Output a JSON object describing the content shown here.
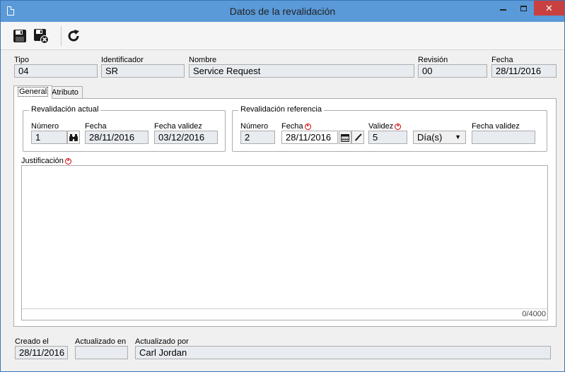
{
  "window": {
    "title": "Datos de la revalidación"
  },
  "header": {
    "tipo": {
      "label": "Tipo",
      "value": "04"
    },
    "identificador": {
      "label": "Identificador",
      "value": "SR"
    },
    "nombre": {
      "label": "Nombre",
      "value": "Service Request"
    },
    "revision": {
      "label": "Revisión",
      "value": "00"
    },
    "fecha": {
      "label": "Fecha",
      "value": "28/11/2016"
    }
  },
  "tabs": [
    {
      "label": "General"
    },
    {
      "label": "Atributo"
    }
  ],
  "revalidacion_actual": {
    "title": "Revalidación actual",
    "numero": {
      "label": "Número",
      "value": "1"
    },
    "fecha": {
      "label": "Fecha",
      "value": "28/11/2016"
    },
    "fecha_validez": {
      "label": "Fecha validez",
      "value": "03/12/2016"
    }
  },
  "revalidacion_referencia": {
    "title": "Revalidación referencia",
    "numero": {
      "label": "Número",
      "value": "2"
    },
    "fecha": {
      "label": "Fecha",
      "value": "28/11/2016"
    },
    "validez": {
      "label": "Validez",
      "value": "5"
    },
    "unidad": {
      "value": "Día(s)"
    },
    "fecha_validez": {
      "label": "Fecha validez",
      "value": ""
    }
  },
  "justificacion": {
    "label": "Justificación",
    "counter": "0/4000"
  },
  "footer": {
    "creado_el": {
      "label": "Creado el",
      "value": "28/11/2016"
    },
    "actualizado_en": {
      "label": "Actualizado en",
      "value": ""
    },
    "actualizado_por": {
      "label": "Actualizado por",
      "value": "Carl Jordan"
    }
  },
  "icons": {
    "save": "save-icon",
    "save_close": "save-close-icon",
    "refresh": "refresh-icon"
  }
}
